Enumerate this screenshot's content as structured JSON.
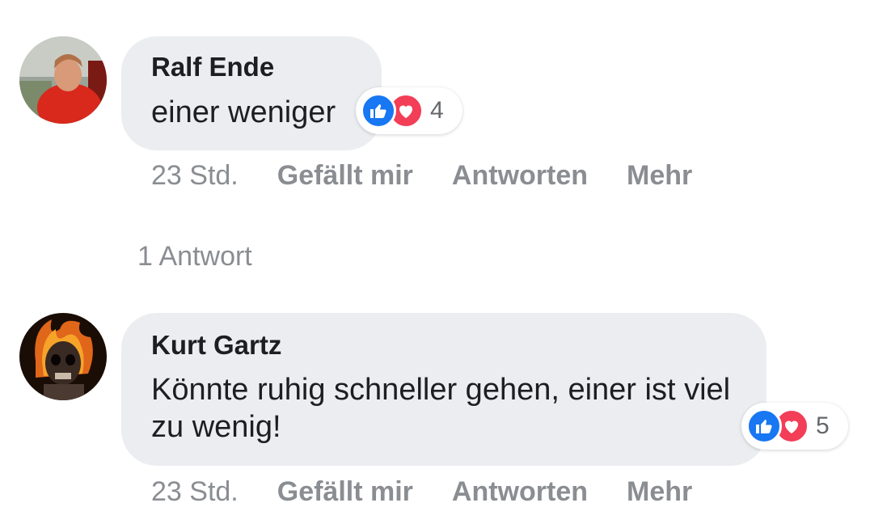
{
  "comments": [
    {
      "author": "Ralf Ende",
      "text": "einer weniger",
      "reaction_count": "4",
      "time": "23 Std.",
      "like_label": "Gefällt mir",
      "reply_label": "Antworten",
      "more_label": "Mehr"
    },
    {
      "author": "Kurt Gartz",
      "text": "Könnte ruhig schneller gehen, einer ist viel zu wenig!",
      "reaction_count": "5",
      "time": "23 Std.",
      "like_label": "Gefällt mir",
      "reply_label": "Antworten",
      "more_label": "Mehr"
    }
  ],
  "replies_link": "1 Antwort",
  "colors": {
    "bubble": "#ebedf0",
    "like": "#1877f2",
    "love": "#f33e58",
    "meta_text": "#8a8d91"
  },
  "icons": [
    "thumbs-up-icon",
    "heart-icon"
  ]
}
